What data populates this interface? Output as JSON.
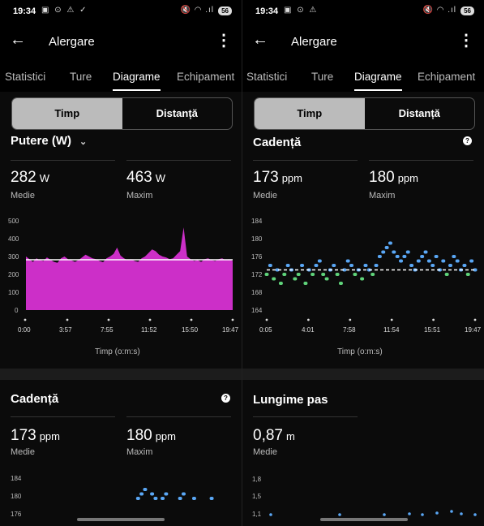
{
  "left": {
    "status": {
      "time": "19:34",
      "icons": "▣ ⊙ ⚠ ✓",
      "right_icons": "🔇 ◠ .ıl",
      "battery": "56"
    },
    "appbar": {
      "title": "Alergare"
    },
    "tabs": [
      "Statistici",
      "Ture",
      "Diagrame",
      "Echipament"
    ],
    "toggle": {
      "time": "Timp",
      "distance": "Distanță"
    },
    "power": {
      "heading": "Putere (W)",
      "avg_value": "282",
      "avg_unit": "W",
      "avg_label": "Medie",
      "max_value": "463",
      "max_unit": "W",
      "max_label": "Maxim",
      "y_ticks": [
        "500",
        "400",
        "300",
        "200",
        "100",
        "0"
      ],
      "x_ticks": [
        "0:00",
        "3:57",
        "7:55",
        "11:52",
        "15:50",
        "19:47"
      ],
      "x_label": "Timp (o:m:s)"
    },
    "cadence": {
      "heading": "Cadență",
      "avg_value": "173",
      "avg_unit": "ppm",
      "avg_label": "Medie",
      "max_value": "180",
      "max_unit": "ppm",
      "max_label": "Maxim",
      "y_ticks": [
        "184",
        "180",
        "176"
      ]
    }
  },
  "right": {
    "status": {
      "time": "19:34",
      "icons": "▣ ⊙ ⚠",
      "right_icons": "🔇 ◠ .ıl",
      "battery": "56"
    },
    "appbar": {
      "title": "Alergare"
    },
    "tabs": [
      "Statistici",
      "Ture",
      "Diagrame",
      "Echipament"
    ],
    "toggle": {
      "time": "Timp",
      "distance": "Distanță"
    },
    "cadence": {
      "heading": "Cadență",
      "avg_value": "173",
      "avg_unit": "ppm",
      "avg_label": "Medie",
      "max_value": "180",
      "max_unit": "ppm",
      "max_label": "Maxim",
      "y_ticks": [
        "184",
        "180",
        "176",
        "172",
        "168",
        "164"
      ],
      "x_ticks": [
        "0:05",
        "4:01",
        "7:58",
        "11:54",
        "15:51",
        "19:47"
      ],
      "x_label": "Timp (o:m:s)"
    },
    "stride": {
      "heading": "Lungime pas",
      "avg_value": "0,87",
      "avg_unit": "m",
      "avg_label": "Medie",
      "y_ticks": [
        "1,8",
        "1,5",
        "1,1"
      ]
    }
  },
  "colors": {
    "power_fill": "#cc2fc8",
    "cadence_above": "#5aa7f5",
    "cadence_below": "#5fd37a",
    "segment_selected": "#bbbbbb"
  },
  "chart_data": [
    {
      "type": "area",
      "title": "Putere (W)",
      "xlabel": "Timp (o:m:s)",
      "ylabel": "",
      "ylim": [
        0,
        500
      ],
      "x_ticks": [
        "0:00",
        "3:57",
        "7:55",
        "11:52",
        "15:50",
        "19:47"
      ],
      "reference_line": 282,
      "series": [
        {
          "values": [
            300,
            285,
            270,
            290,
            280,
            275,
            295,
            282,
            270,
            265,
            290,
            300,
            285,
            278,
            270,
            280,
            295,
            310,
            300,
            290,
            285,
            275,
            268,
            290,
            300,
            315,
            350,
            305,
            290,
            280,
            285,
            275,
            270,
            290,
            300,
            320,
            340,
            330,
            310,
            300,
            295,
            285,
            290,
            310,
            330,
            463,
            300,
            285,
            275,
            280,
            270,
            285,
            290,
            280,
            275,
            285,
            290,
            280,
            285,
            275
          ]
        }
      ]
    },
    {
      "type": "scatter",
      "title": "Cadență",
      "xlabel": "Timp (o:m:s)",
      "ylabel": "",
      "ylim": [
        164,
        184
      ],
      "x_ticks": [
        "0:05",
        "4:01",
        "7:58",
        "11:54",
        "15:51",
        "19:47"
      ],
      "reference_line": 173,
      "series": [
        {
          "values": [
            172,
            174,
            171,
            173,
            170,
            172,
            174,
            173,
            171,
            172,
            174,
            170,
            173,
            172,
            174,
            175,
            172,
            171,
            173,
            174,
            172,
            170,
            173,
            175,
            174,
            172,
            173,
            171,
            174,
            173,
            172,
            174,
            176,
            177,
            178,
            179,
            177,
            176,
            175,
            176,
            177,
            174,
            173,
            175,
            176,
            177,
            175,
            174,
            176,
            173,
            175,
            172,
            174,
            176,
            175,
            173,
            174,
            172,
            175,
            173
          ]
        }
      ]
    }
  ]
}
